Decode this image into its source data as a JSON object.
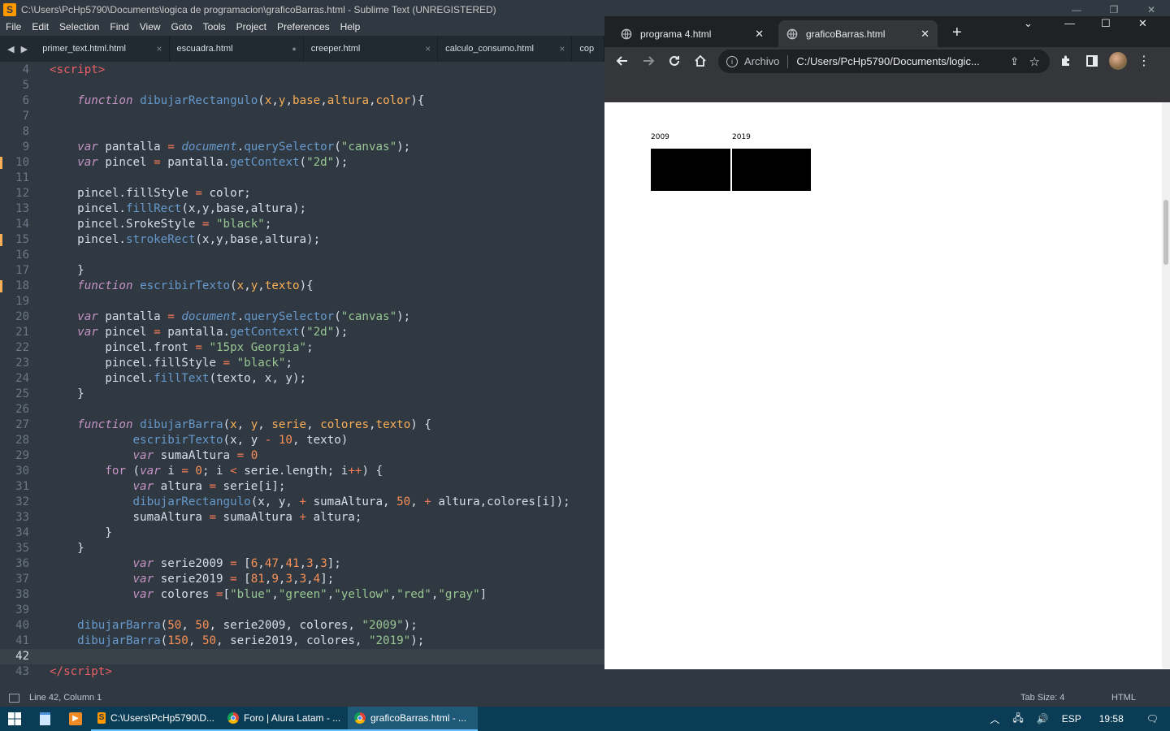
{
  "sublime": {
    "title": "C:\\Users\\PcHp5790\\Documents\\logica de programacion\\graficoBarras.html - Sublime Text (UNREGISTERED)",
    "menu": [
      "File",
      "Edit",
      "Selection",
      "Find",
      "View",
      "Goto",
      "Tools",
      "Project",
      "Preferences",
      "Help"
    ],
    "tabs": [
      {
        "label": "primer_text.html.html",
        "close": "×"
      },
      {
        "label": "escuadra.html",
        "close": "●"
      },
      {
        "label": "creeper.html",
        "close": "×"
      },
      {
        "label": "calculo_consumo.html",
        "close": "×"
      },
      {
        "label": "cop",
        "close": ""
      }
    ],
    "status": {
      "position": "Line 42, Column 1",
      "tab_size": "Tab Size: 4",
      "syntax": "HTML"
    },
    "current_line": 42,
    "modified_lines": [
      10,
      15,
      18
    ]
  },
  "chrome": {
    "tabs": [
      {
        "label": "programa 4.html",
        "active": false
      },
      {
        "label": "graficoBarras.html",
        "active": true
      }
    ],
    "omnibox": {
      "scheme": "Archivo",
      "url": "C:/Users/PcHp5790/Documents/logic..."
    },
    "canvas": {
      "labels": [
        "2009",
        "2019"
      ]
    }
  },
  "taskbar": {
    "items": [
      {
        "label": "C:\\Users\\PcHp5790\\D..."
      },
      {
        "label": "Foro | Alura Latam - ..."
      },
      {
        "label": "graficoBarras.html - ..."
      }
    ],
    "language": "ESP",
    "time": "19:58"
  },
  "code": [
    {
      "n": 4,
      "html": "<span class=\"tag\">&lt;script&gt;</span>"
    },
    {
      "n": 5,
      "html": ""
    },
    {
      "n": 6,
      "html": "    <span class=\"kw\">function</span> <span class=\"fn\">dibujarRectangulo</span>(<span class=\"prm\">x</span>,<span class=\"prm\">y</span>,<span class=\"prm\">base</span>,<span class=\"prm\">altura</span>,<span class=\"prm\">color</span>){"
    },
    {
      "n": 7,
      "html": ""
    },
    {
      "n": 8,
      "html": ""
    },
    {
      "n": 9,
      "html": "    <span class=\"kw\">var</span> pantalla <span class=\"op\">=</span> <span class=\"dom\">document</span>.<span class=\"fn\">querySelector</span>(<span class=\"str\">\"canvas\"</span>);"
    },
    {
      "n": 10,
      "html": "    <span class=\"kw\">var</span> pincel <span class=\"op\">=</span> pantalla.<span class=\"fn\">getContext</span>(<span class=\"str\">\"2d\"</span>);"
    },
    {
      "n": 11,
      "html": ""
    },
    {
      "n": 12,
      "html": "    pincel.fillStyle <span class=\"op\">=</span> color;"
    },
    {
      "n": 13,
      "html": "    pincel.<span class=\"fn\">fillRect</span>(x,y,base,altura);"
    },
    {
      "n": 14,
      "html": "    pincel.SrokeStyle <span class=\"op\">=</span> <span class=\"str\">\"black\"</span>;"
    },
    {
      "n": 15,
      "html": "    pincel.<span class=\"fn\">strokeRect</span>(x,y,base,altura);"
    },
    {
      "n": 16,
      "html": ""
    },
    {
      "n": 17,
      "html": "    }"
    },
    {
      "n": 18,
      "html": "    <span class=\"kw\">function</span> <span class=\"fn\">escribirTexto</span>(<span class=\"prm\">x</span>,<span class=\"prm\">y</span>,<span class=\"prm\">texto</span>){"
    },
    {
      "n": 19,
      "html": ""
    },
    {
      "n": 20,
      "html": "    <span class=\"kw\">var</span> pantalla <span class=\"op\">=</span> <span class=\"dom\">document</span>.<span class=\"fn\">querySelector</span>(<span class=\"str\">\"canvas\"</span>);"
    },
    {
      "n": 21,
      "html": "    <span class=\"kw\">var</span> pincel <span class=\"op\">=</span> pantalla.<span class=\"fn\">getContext</span>(<span class=\"str\">\"2d\"</span>);"
    },
    {
      "n": 22,
      "html": "        pincel.front <span class=\"op\">=</span> <span class=\"str\">\"15px Georgia\"</span>;"
    },
    {
      "n": 23,
      "html": "        pincel.fillStyle <span class=\"op\">=</span> <span class=\"str\">\"black\"</span>;"
    },
    {
      "n": 24,
      "html": "        pincel.<span class=\"fn\">fillText</span>(texto, x, y);"
    },
    {
      "n": 25,
      "html": "    }"
    },
    {
      "n": 26,
      "html": ""
    },
    {
      "n": 27,
      "html": "    <span class=\"kw\">function</span> <span class=\"fn\">dibujarBarra</span>(<span class=\"prm\">x</span>, <span class=\"prm\">y</span>, <span class=\"prm\">serie</span>, <span class=\"prm\">colores</span>,<span class=\"prm\">texto</span>) {"
    },
    {
      "n": 28,
      "html": "            <span class=\"fn\">escribirTexto</span>(x, y <span class=\"op\">-</span> <span class=\"num\">10</span>, texto)"
    },
    {
      "n": 29,
      "html": "            <span class=\"kw\">var</span> sumaAltura <span class=\"op\">=</span> <span class=\"num\">0</span>"
    },
    {
      "n": 30,
      "html": "        <span class=\"kw\" style=\"font-style:normal\">for</span> (<span class=\"kw\">var</span> i <span class=\"op\">=</span> <span class=\"num\">0</span>; i <span class=\"op\">&lt;</span> serie.length; i<span class=\"op\">++</span>) {"
    },
    {
      "n": 31,
      "html": "            <span class=\"kw\">var</span> altura <span class=\"op\">=</span> serie[i];"
    },
    {
      "n": 32,
      "html": "            <span class=\"fn\">dibujarRectangulo</span>(x, y, <span class=\"op\">+</span> sumaAltura, <span class=\"num\">50</span>, <span class=\"op\">+</span> altura,colores[i]);"
    },
    {
      "n": 33,
      "html": "            sumaAltura <span class=\"op\">=</span> sumaAltura <span class=\"op\">+</span> altura;"
    },
    {
      "n": 34,
      "html": "        }"
    },
    {
      "n": 35,
      "html": "    }"
    },
    {
      "n": 36,
      "html": "            <span class=\"kw\">var</span> serie2009 <span class=\"op\">=</span> [<span class=\"num\">6</span>,<span class=\"num\">47</span>,<span class=\"num\">41</span>,<span class=\"num\">3</span>,<span class=\"num\">3</span>];"
    },
    {
      "n": 37,
      "html": "            <span class=\"kw\">var</span> serie2019 <span class=\"op\">=</span> [<span class=\"num\">81</span>,<span class=\"num\">9</span>,<span class=\"num\">3</span>,<span class=\"num\">3</span>,<span class=\"num\">4</span>];"
    },
    {
      "n": 38,
      "html": "            <span class=\"kw\">var</span> colores <span class=\"op\">=</span>[<span class=\"str\">\"blue\"</span>,<span class=\"str\">\"green\"</span>,<span class=\"str\">\"yellow\"</span>,<span class=\"str\">\"red\"</span>,<span class=\"str\">\"gray\"</span>]"
    },
    {
      "n": 39,
      "html": ""
    },
    {
      "n": 40,
      "html": "    <span class=\"fn\">dibujarBarra</span>(<span class=\"num\">50</span>, <span class=\"num\">50</span>, serie2009, colores, <span class=\"str\">\"2009\"</span>);"
    },
    {
      "n": 41,
      "html": "    <span class=\"fn\">dibujarBarra</span>(<span class=\"num\">150</span>, <span class=\"num\">50</span>, serie2019, colores, <span class=\"str\">\"2019\"</span>);"
    },
    {
      "n": 42,
      "html": ""
    },
    {
      "n": 43,
      "html": "<span class=\"tag\">&lt;/script&gt;</span>"
    }
  ]
}
